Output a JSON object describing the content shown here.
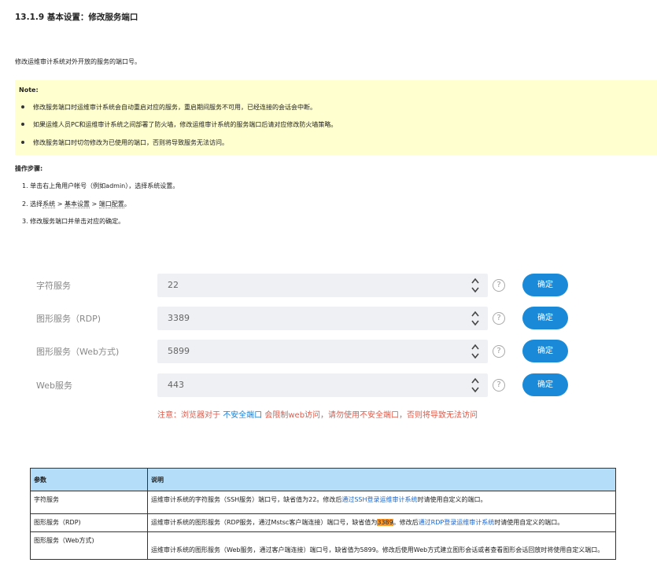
{
  "doc": {
    "title": "13.1.9 基本设置：修改服务端口",
    "intro": "修改运维审计系统对外开放的服务的端口号。"
  },
  "note": {
    "title": "Note:",
    "items": [
      "修改服务端口时运维审计系统会自动重启对应的服务，重启期间服务不可用，已经连接的会话会中断。",
      "如果运维人员PC和运维审计系统之间部署了防火墙，修改运维审计系统的服务端口后请对应修改防火墙策略。",
      "修改服务端口时切勿修改为已使用的端口，否则将导致服务无法访问。"
    ]
  },
  "steps": {
    "title": "操作步骤:",
    "s1": "1. 单击右上角用户帐号（例如admin），选择系统设置。",
    "s2_prefix": "2. 选择",
    "s2_a": "系统",
    "s2_sep1": " > ",
    "s2_b": "基本设置",
    "s2_sep2": " > ",
    "s2_c": "端口配置",
    "s2_suffix": "。",
    "s3": "3. 修改服务端口并单击对应的确定。"
  },
  "form": {
    "rows": [
      {
        "label": "字符服务",
        "value": "22",
        "button": "确定"
      },
      {
        "label": "图形服务（RDP)",
        "value": "3389",
        "button": "确定"
      },
      {
        "label": "图形服务（Web方式)",
        "value": "5899",
        "button": "确定"
      },
      {
        "label": "Web服务",
        "value": "443",
        "button": "确定"
      }
    ],
    "help_glyph": "?",
    "warning_prefix": "注意：浏览器对于 ",
    "warning_link": "不安全端口",
    "warning_suffix": " 会限制web访问，请勿使用不安全端口，否则将导致无法访问"
  },
  "table": {
    "headers": [
      "参数",
      "说明"
    ],
    "rows": [
      {
        "param": "字符服务",
        "desc_pre": "运维审计系统的字符服务（SSH服务）端口号，缺省值为22。修改后",
        "desc_link": "通过SSH登录运维审计系统",
        "desc_post": "时请使用自定义的端口。"
      },
      {
        "param": "图形服务（RDP)",
        "desc_pre": "运维审计系统的图形服务（RDP服务，通过Mstsc客户端连接）端口号，缺省值为",
        "desc_hl": "3389",
        "desc_mid": "。修改后",
        "desc_link": "通过RDP登录运维审计系统",
        "desc_post": "时请使用自定义的端口。"
      },
      {
        "param": "图形服务（Web方式)",
        "desc": "运维审计系统的图形服务（Web服务，通过客户端连接）端口号，缺省值为5899。修改后使用Web方式建立图形会话或者查看图形会话回放时将使用自定义端口。"
      }
    ]
  },
  "colors": {
    "note_bg": "#ffffd0",
    "button": "#1a8ad8",
    "warning": "#e05a4a",
    "link": "#1e64c8",
    "table_header": "#b3ddf8",
    "highlight": "#ff9d2a"
  },
  "icons": [
    "question-circle-icon",
    "spinner-up-icon",
    "spinner-down-icon"
  ]
}
